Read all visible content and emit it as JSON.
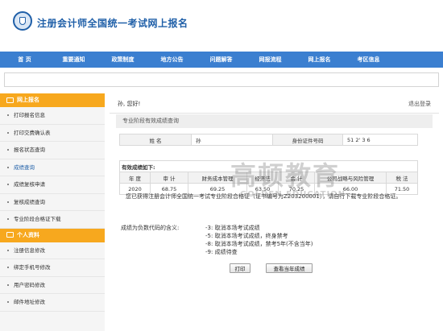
{
  "site": {
    "title": "注册会计师全国统一考试网上报名"
  },
  "nav": [
    "首 页",
    "重要通知",
    "政策制度",
    "地方公告",
    "问题解答",
    "网报流程",
    "网上报名",
    "考区信息"
  ],
  "sidebar": {
    "sections": [
      {
        "title": "网上报名",
        "items": [
          "打印报名信息",
          "打印交费确认表",
          "报名状态查询",
          "成绩查询",
          "成绩复核申请",
          "复核成绩查询",
          "专业阶段合格证下载"
        ],
        "active_index": 3
      },
      {
        "title": "个人资料",
        "items": [
          "注册信息修改",
          "绑定手机号修改",
          "用户密码修改",
          "邮件地址修改"
        ]
      }
    ]
  },
  "main": {
    "greeting": "孙, 您好!",
    "logout": "退出登录",
    "section_title": "专业阶段有效成绩查询",
    "info": {
      "name_label": "姓 名",
      "name_value": "孙",
      "id_label": "身份证件号码",
      "id_value": "51 2'    3   6"
    },
    "scores": {
      "caption": "有效成绩如下:",
      "headers": [
        "年 度",
        "审 计",
        "财务成本管理",
        "经济法",
        "会 计",
        "公司战略与风险管理",
        "税 法"
      ],
      "rows": [
        [
          "2020",
          "68.75",
          "69.25",
          "63.50",
          "70.25",
          "66.00",
          "71.50"
        ]
      ]
    },
    "notice": "您已获得注册会计师全国统一考试专业阶段合格证（证书编号为Z203200001），请自行下载专业阶段合格证。",
    "legend_label": "成绩为负数代码的含义:",
    "codes": [
      "-3: 取消本场考试成绩",
      "-5: 取消本场考试成绩，终身禁考",
      "-8: 取消本场考试成绩，禁考5年(不含当年)",
      "-9: 成绩待查"
    ],
    "buttons": {
      "print": "打印",
      "view_year": "查看当年成绩"
    }
  },
  "watermark": {
    "text": "高顿教育",
    "sub": "GOLDEN EDUCATION"
  }
}
